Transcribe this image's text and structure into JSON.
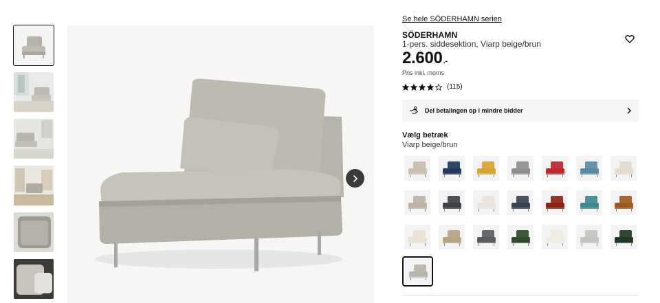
{
  "gallery": {
    "thumbnails": [
      {
        "name": "thumb-product-front",
        "selected": true
      },
      {
        "name": "thumb-room-scene"
      },
      {
        "name": "thumb-room-scene-2"
      },
      {
        "name": "thumb-living-room"
      },
      {
        "name": "thumb-fabric-detail"
      },
      {
        "name": "thumb-cushion-detail"
      }
    ],
    "next_label": "chevron-right-icon"
  },
  "product": {
    "series_link": "Se hele SÖDERHAMN serien",
    "name": "SÖDERHAMN",
    "description": "1-pers. siddesektion, Viarp beige/brun",
    "price": "2.600",
    "price_suffix": ".-",
    "vat_note": "Pris inkl. moms",
    "rating": 4,
    "rating_max": 5,
    "review_count": "(115)",
    "favorite_icon": "heart-icon"
  },
  "payment": {
    "label": "Del betalingen op i mindre bidder",
    "icon": "hand-coin-icon"
  },
  "cover": {
    "title": "Vælg betræk",
    "selected": "Viarp beige/brun"
  },
  "colors": {
    "beige": "#cbbfae",
    "navy": "#1f3a5c",
    "yellow": "#d8a52a",
    "grey": "#8e8e8e",
    "red": "#c0262e",
    "blue": "#5b8ca6",
    "cream": "#e4ddd0",
    "taupe": "#bdb3a5",
    "charcoal": "#3f4347",
    "offwhite": "#ece4dc",
    "slate": "#3a4350",
    "rust": "#8c2414",
    "teal": "#3e8a94",
    "ochre": "#a05a1e",
    "ivory": "#e9e3d6",
    "sand": "#b8a486",
    "darkgrey": "#5a5d60",
    "green": "#2f4b2a",
    "white": "#eeece0",
    "lightgrey": "#c4c4c0",
    "darkgreen": "#1e3a24",
    "viarp": "#b7b4ab"
  }
}
